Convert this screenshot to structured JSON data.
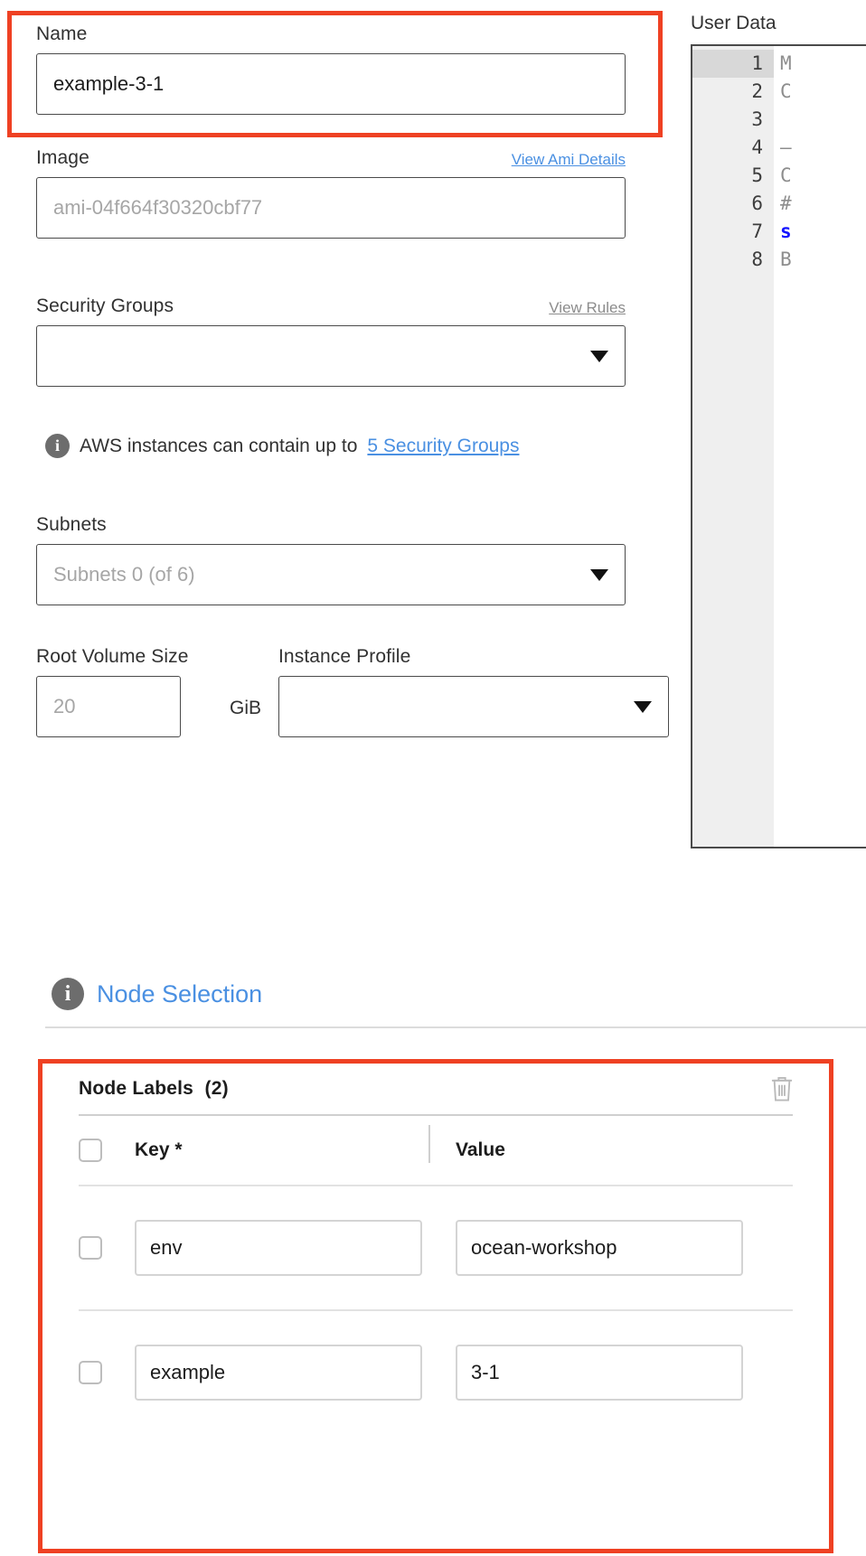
{
  "annotations": {
    "highlight_color": "#ef4123",
    "boxes": [
      "name-field",
      "node-labels-card"
    ]
  },
  "form": {
    "name": {
      "label": "Name",
      "value": "example-3-1",
      "placeholder": "Name"
    },
    "image": {
      "label": "Image",
      "link_label": "View Ami Details",
      "placeholder": "ami-04f664f30320cbf77",
      "value": ""
    },
    "security_groups": {
      "label": "Security Groups",
      "link_label": "View Rules",
      "value": "",
      "placeholder": "",
      "caret_icon": "chevron-down-icon",
      "note_text": "AWS instances can contain up to",
      "note_link": "5 Security Groups",
      "note_icon": "info-icon"
    },
    "subnets": {
      "label": "Subnets",
      "placeholder": "Subnets 0 (of 6)",
      "value": "",
      "caret_icon": "chevron-down-icon"
    },
    "root_volume_size": {
      "label": "Root Volume Size",
      "placeholder": "20",
      "value": "",
      "unit": "GiB"
    },
    "instance_profile": {
      "label": "Instance Profile",
      "value": "",
      "placeholder": "",
      "caret_icon": "chevron-down-icon"
    }
  },
  "user_data": {
    "title": "User Data",
    "lines": [
      {
        "number": "1",
        "text": "M",
        "kind": "plain",
        "active": true
      },
      {
        "number": "2",
        "text": "C",
        "kind": "plain",
        "active": false
      },
      {
        "number": "3",
        "text": "",
        "kind": "plain",
        "active": false
      },
      {
        "number": "4",
        "text": "–",
        "kind": "plain",
        "active": false
      },
      {
        "number": "5",
        "text": "C",
        "kind": "plain",
        "active": false
      },
      {
        "number": "6",
        "text": "#",
        "kind": "plain",
        "active": false
      },
      {
        "number": "7",
        "text": "s",
        "kind": "keyword",
        "active": false
      },
      {
        "number": "8",
        "text": "B",
        "kind": "plain",
        "active": false
      }
    ]
  },
  "node_selection": {
    "label": "Node Selection",
    "icon": "info-icon",
    "link_color": "#4a90e2"
  },
  "node_labels": {
    "title": "Node Labels",
    "count": "(2)",
    "delete_icon": "trash-icon",
    "columns": {
      "key": "Key  *",
      "value": "Value"
    },
    "rows": [
      {
        "key": "env",
        "value": "ocean-workshop",
        "selected": false
      },
      {
        "key": "example",
        "value": "3-1",
        "selected": false
      }
    ]
  }
}
